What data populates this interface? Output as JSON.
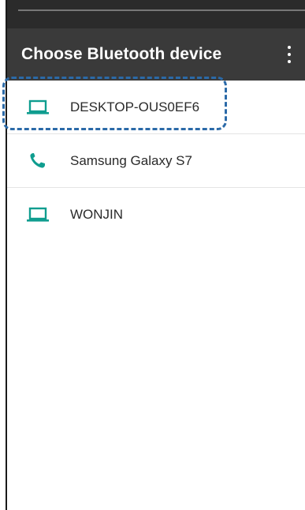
{
  "app_bar": {
    "title": "Choose Bluetooth device",
    "menu_icon": "more-vert-icon"
  },
  "devices": [
    {
      "name": "DESKTOP-OUS0EF6",
      "icon": "laptop-icon"
    },
    {
      "name": "Samsung Galaxy S7",
      "icon": "phone-icon"
    },
    {
      "name": "WONJIN",
      "icon": "laptop-icon"
    }
  ],
  "colors": {
    "accent": "#0f9d8f",
    "app_bar": "#3a3a3a",
    "status_bar": "#2b2b2b",
    "highlight": "#2b6aa8"
  }
}
